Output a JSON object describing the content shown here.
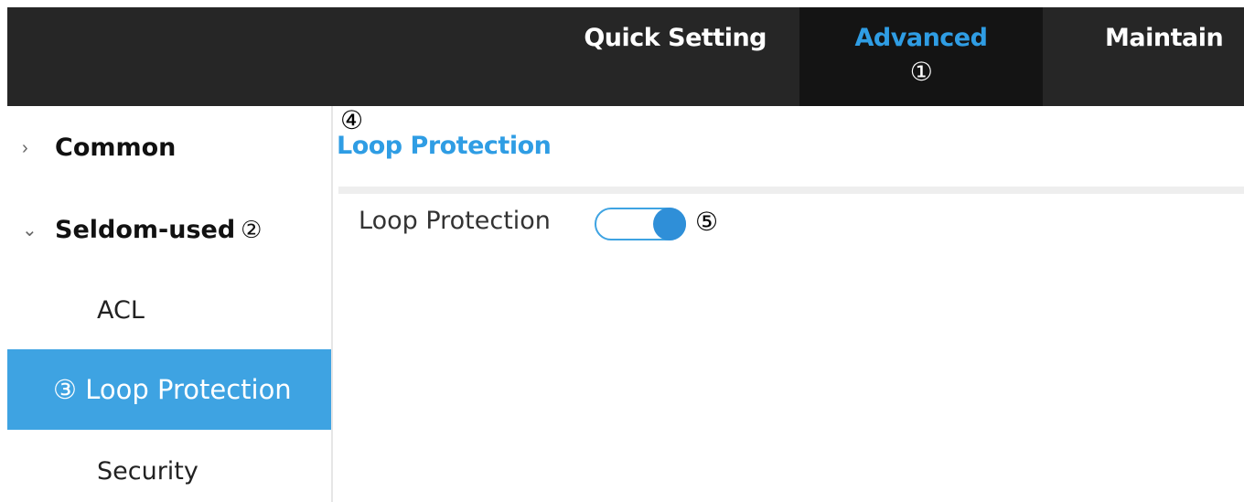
{
  "topnav": {
    "tabs": [
      {
        "label": "Quick Setting",
        "active": false
      },
      {
        "label": "Advanced",
        "active": true,
        "marker": "①"
      },
      {
        "label": "Maintain",
        "active": false
      }
    ]
  },
  "sidebar": {
    "groups": [
      {
        "label": "Common",
        "expanded": false,
        "chevron": "›"
      },
      {
        "label": "Seldom-used",
        "expanded": true,
        "chevron": "⌄",
        "marker": "②"
      }
    ],
    "items": [
      {
        "label": "ACL",
        "active": false
      },
      {
        "label": "Loop Protection",
        "active": true,
        "marker": "③"
      },
      {
        "label": "Security",
        "active": false
      }
    ]
  },
  "main": {
    "marker": "④",
    "title": "Loop Protection",
    "field": {
      "label": "Loop Protection",
      "enabled": true,
      "marker": "⑤"
    }
  },
  "colors": {
    "accent": "#2f9de4",
    "topbar": "#262626",
    "active_tab_bg": "#141414",
    "active_item_bg": "#3ea3e2"
  }
}
